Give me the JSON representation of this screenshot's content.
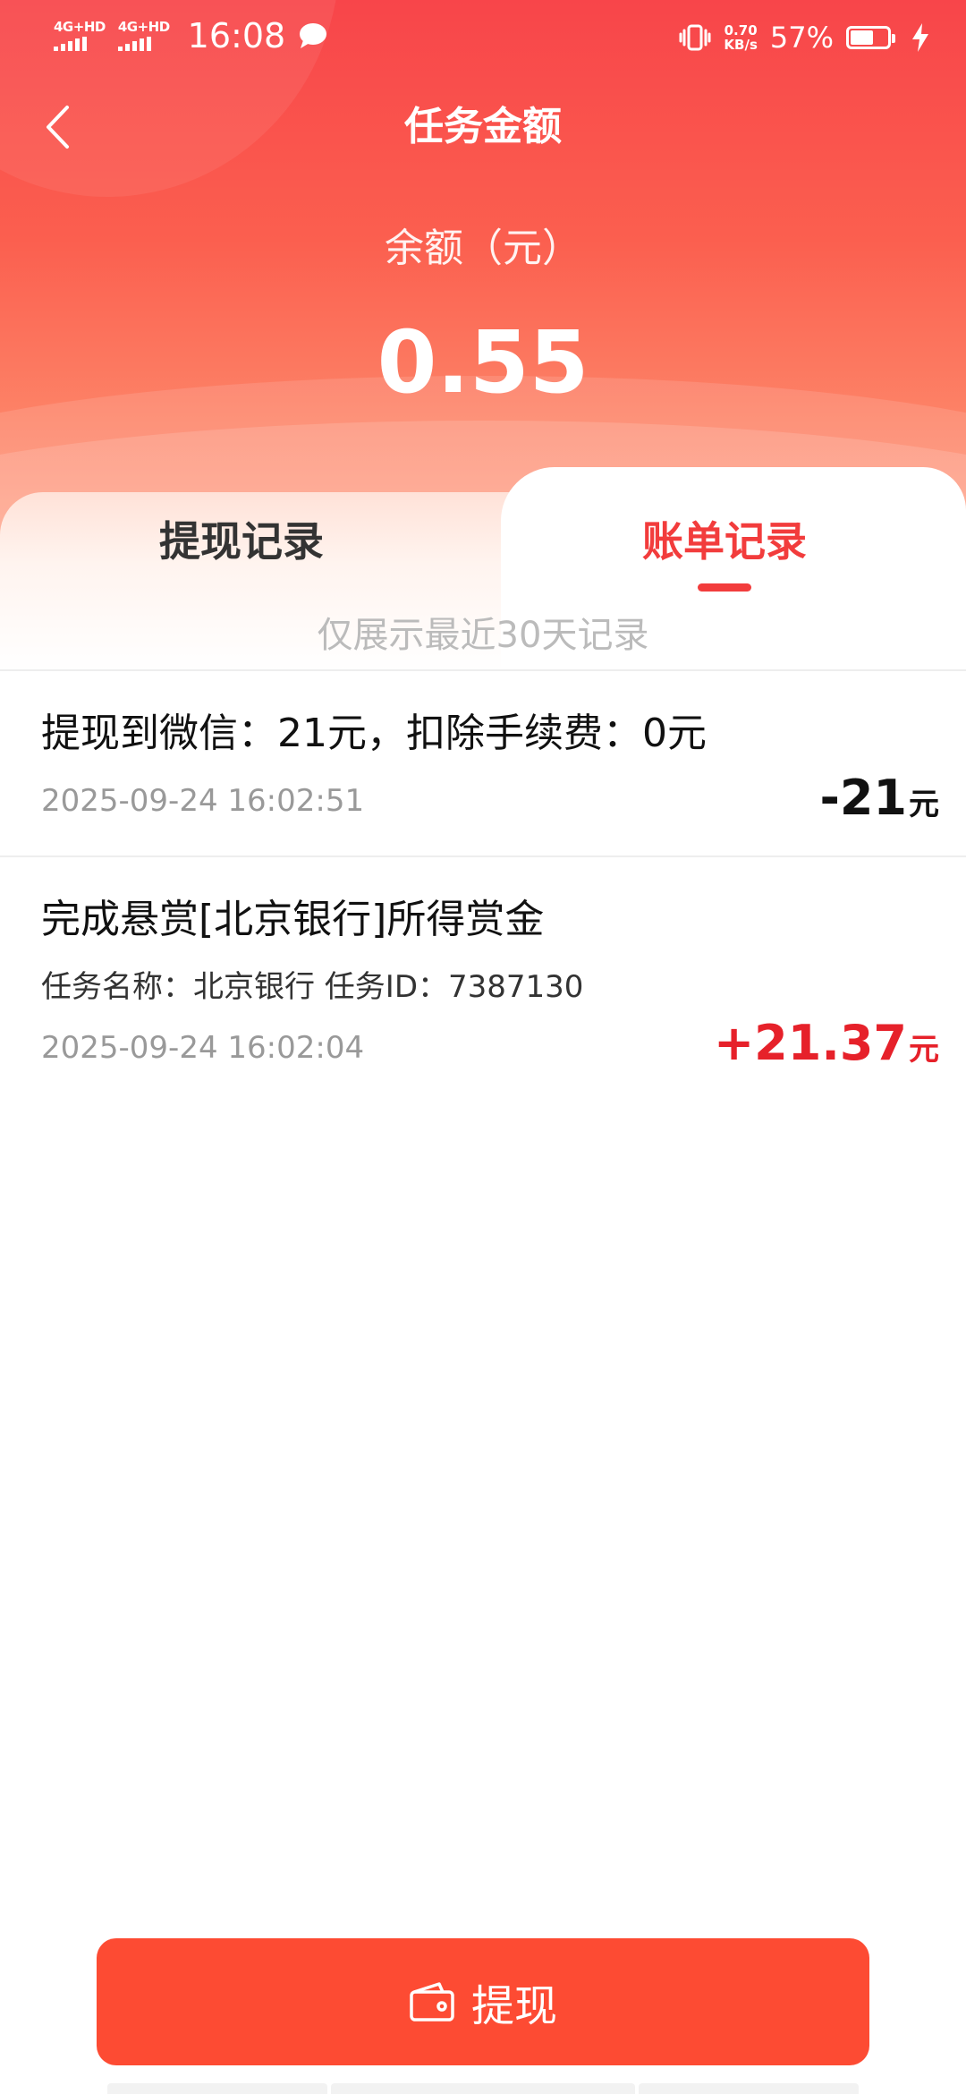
{
  "status_bar": {
    "network1": "4G+HD",
    "network2": "4G+HD",
    "time": "16:08",
    "speed_value": "0.70",
    "speed_unit": "KB/s",
    "battery_percent": "57%"
  },
  "header": {
    "title": "任务金额",
    "balance_label": "余额（元）",
    "balance_value": "0.55"
  },
  "tabs": [
    {
      "label": "提现记录",
      "active": false
    },
    {
      "label": "账单记录",
      "active": true
    }
  ],
  "notice": "仅展示最近30天记录",
  "records": [
    {
      "title": "提现到微信：21元，扣除手续费：0元",
      "time": "2025-09-24 16:02:51",
      "amount": "-21",
      "unit": "元"
    },
    {
      "title": "完成悬赏[北京银行]所得赏金",
      "detail": "任务名称：北京银行   任务ID：7387130",
      "time": "2025-09-24 16:02:04",
      "amount": "+21.37",
      "unit": "元"
    }
  ],
  "withdraw_button": {
    "label": "提现",
    "icon": "wallet-icon"
  },
  "colors": {
    "accent": "#f23c3c",
    "button": "#fd4b33",
    "positive_amount": "#e6212a"
  }
}
